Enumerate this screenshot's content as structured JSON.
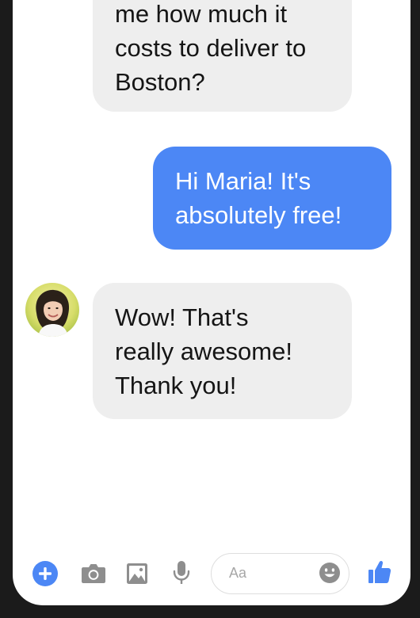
{
  "conversation": {
    "messages": [
      {
        "side": "incoming",
        "lines": [
          "me how much it",
          "costs to deliver to",
          "Boston?"
        ]
      },
      {
        "side": "outgoing",
        "lines": [
          "Hi Maria! It's",
          "absolutely free!"
        ]
      },
      {
        "side": "incoming",
        "lines": [
          "Wow! That's",
          "really awesome!",
          "Thank you!"
        ]
      }
    ]
  },
  "composer": {
    "placeholder": "Aa"
  },
  "icons": {
    "add": "plus-circle-icon",
    "camera": "camera-icon",
    "gallery": "image-icon",
    "mic": "microphone-icon",
    "emoji": "smiley-icon",
    "like": "thumbs-up-icon"
  },
  "colors": {
    "accent": "#4c87f5",
    "incoming_bubble": "#eeeeee",
    "icon_gray": "#8e8e8e",
    "text": "#151515"
  }
}
